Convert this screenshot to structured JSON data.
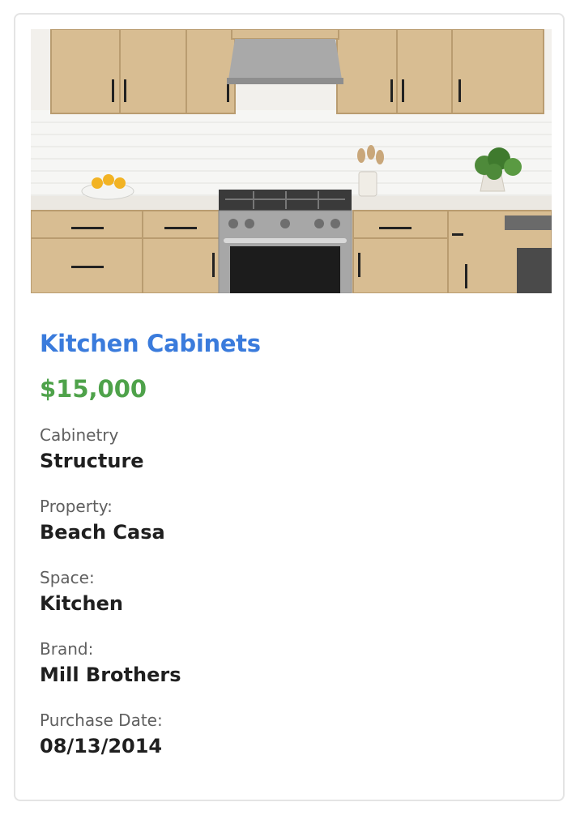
{
  "item": {
    "title": "Kitchen Cabinets",
    "price": "$15,000",
    "category": "Cabinetry",
    "type": "Structure",
    "property_label": "Property:",
    "property_value": "Beach Casa",
    "space_label": "Space:",
    "space_value": "Kitchen",
    "brand_label": "Brand:",
    "brand_value": "Mill Brothers",
    "purchase_date_label": "Purchase Date:",
    "purchase_date_value": "08/13/2014"
  },
  "colors": {
    "title": "#3a7bdc",
    "price": "#4ea24a",
    "label": "#5f5f5f",
    "value": "#1f1f1f",
    "border": "#e4e4e4"
  }
}
